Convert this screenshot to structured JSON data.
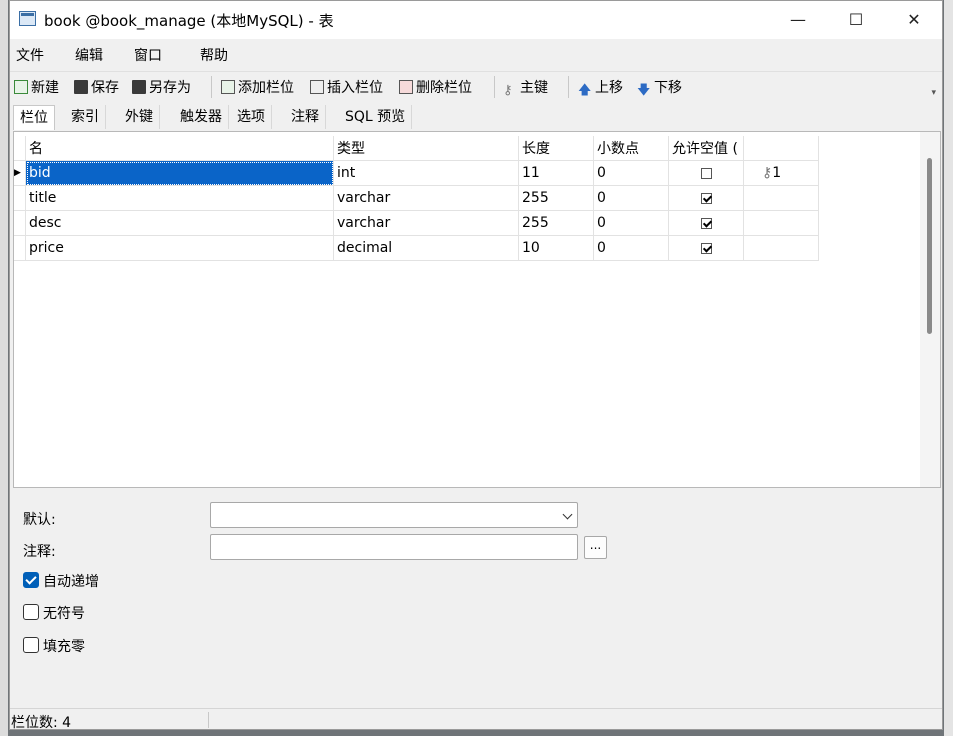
{
  "window": {
    "title": "book @book_manage (本地MySQL) - 表",
    "minimize": "—",
    "maximize": "☐",
    "close": "✕"
  },
  "menu": [
    "文件",
    "编辑",
    "窗口",
    "帮助"
  ],
  "toolbar": {
    "new": "新建",
    "save": "保存",
    "save_as": "另存为",
    "add_field": "添加栏位",
    "insert_field": "插入栏位",
    "delete_field": "删除栏位",
    "primary_key": "主键",
    "move_up": "上移",
    "move_down": "下移"
  },
  "tabs": [
    "栏位",
    "索引",
    "外键",
    "触发器",
    "选项",
    "注释",
    "SQL 预览"
  ],
  "grid": {
    "headers": [
      "名",
      "类型",
      "长度",
      "小数点",
      "允许空值 (",
      ""
    ],
    "rows": [
      {
        "name": "bid",
        "type": "int",
        "length": "11",
        "decimals": "0",
        "nullable": false,
        "key": "1"
      },
      {
        "name": "title",
        "type": "varchar",
        "length": "255",
        "decimals": "0",
        "nullable": true,
        "key": ""
      },
      {
        "name": "desc",
        "type": "varchar",
        "length": "255",
        "decimals": "0",
        "nullable": true,
        "key": ""
      },
      {
        "name": "price",
        "type": "decimal",
        "length": "10",
        "decimals": "0",
        "nullable": true,
        "key": ""
      }
    ]
  },
  "properties": {
    "default_label": "默认:",
    "default_value": "",
    "comment_label": "注释:",
    "comment_value": "",
    "comment_button": "...",
    "auto_increment": "自动递增",
    "auto_increment_checked": true,
    "unsigned": "无符号",
    "unsigned_checked": false,
    "zerofill": "填充零",
    "zerofill_checked": false
  },
  "status": "栏位数: 4"
}
